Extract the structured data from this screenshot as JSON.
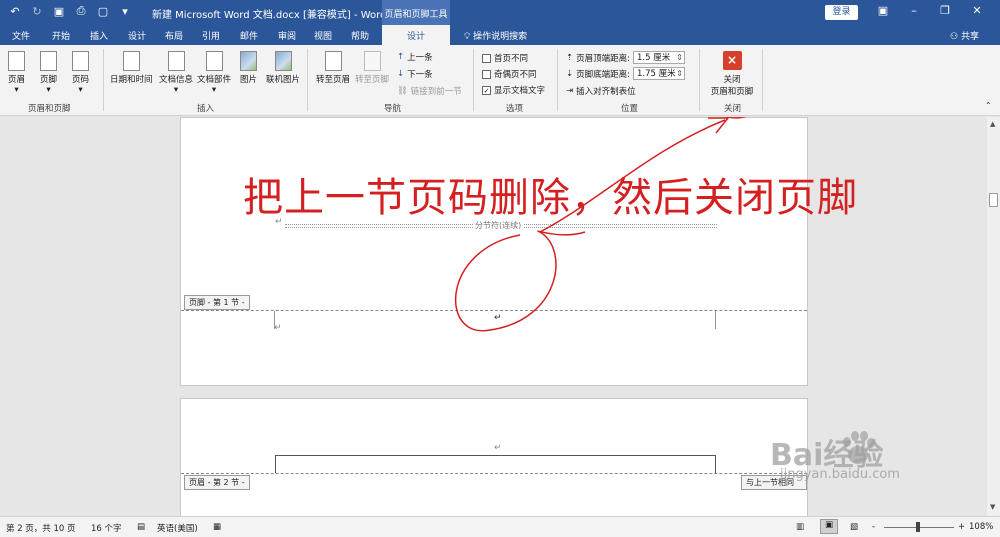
{
  "titlebar": {
    "doc_title": "新建 Microsoft Word 文档.docx [兼容模式] - Word",
    "context_tools": "页眉和页脚工具",
    "login": "登录",
    "qat_icons": [
      "undo-icon",
      "redo-icon",
      "save-icon",
      "print-icon",
      "new-doc-icon",
      "customize-icon"
    ]
  },
  "tabs": [
    "文件",
    "开始",
    "插入",
    "设计",
    "布局",
    "引用",
    "邮件",
    "审阅",
    "视图",
    "帮助"
  ],
  "active_tab": "设计",
  "tell_me": "操作说明搜索",
  "share": "共享",
  "ribbon": {
    "group_hf": {
      "label": "页眉和页脚",
      "buttons": [
        "页眉",
        "页脚",
        "页码"
      ]
    },
    "group_insert": {
      "label": "插入",
      "buttons": [
        "日期和时间",
        "文档信息",
        "文档部件",
        "图片",
        "联机图片"
      ]
    },
    "group_nav": {
      "label": "导航",
      "goto_header": "转至页眉",
      "goto_footer": "转至页脚",
      "prev": "上一条",
      "next": "下一条",
      "link_prev": "链接到前一节"
    },
    "group_options": {
      "label": "选项",
      "first_page": "首页不同",
      "odd_even": "奇偶页不同",
      "show_text": "显示文档文字",
      "show_text_checked": "✓"
    },
    "group_position": {
      "label": "位置",
      "header_top": "页眉顶端距离:",
      "header_top_value": "1.5 厘米",
      "footer_bottom": "页脚底端距离:",
      "footer_bottom_value": "1.75 厘米",
      "insert_align_tab": "插入对齐制表位"
    },
    "group_close": {
      "label": "关闭",
      "close_line1": "关闭",
      "close_line2": "页眉和页脚",
      "close_icon": "×"
    }
  },
  "document": {
    "section_break": "分节符(连续)",
    "footer_tag": "页脚 - 第 1 节 -",
    "header_tag": "页眉 - 第 2 节 -",
    "same_as_prev": "与上一节相同",
    "para_mark": "↵"
  },
  "annotation": "把上一节页码删除，然后关闭页脚",
  "watermark": {
    "brand": "Bai经验",
    "url": "jingyan.baidu.com"
  },
  "statusbar": {
    "page": "第 2 页，共 10 页",
    "words": "16 个字",
    "language": "英语(美国)",
    "zoom": "108%",
    "zoom_minus": "-",
    "zoom_plus": "+"
  },
  "colors": {
    "title_blue": "#2b579a",
    "annotation_red": "#d42020",
    "close_red": "#d5402c"
  }
}
